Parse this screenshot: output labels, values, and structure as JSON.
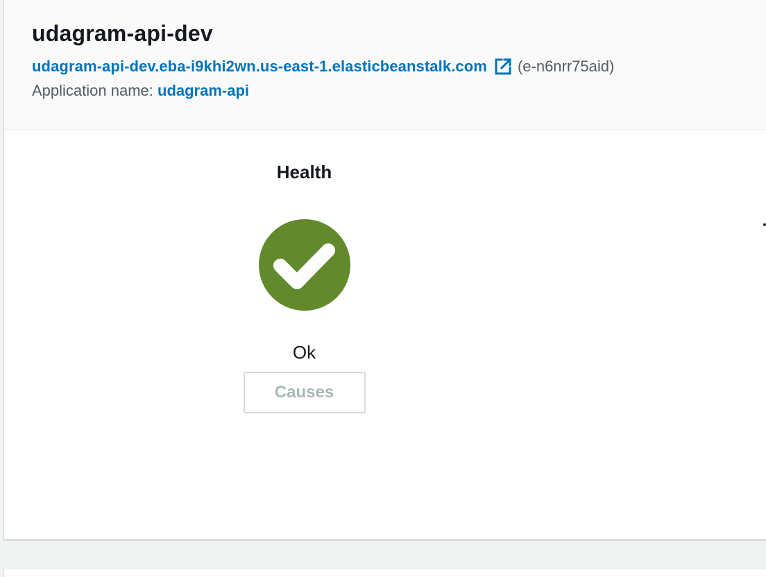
{
  "environment": {
    "name": "udagram-api-dev",
    "url": "udagram-api-dev.eba-i9khi2wn.us-east-1.elasticbeanstalk.com",
    "id": "(e-n6nrr75aid)",
    "application_label": "Application name: ",
    "application_name": "udagram-api",
    "external_link_icon": "external-link-icon"
  },
  "health": {
    "heading": "Health",
    "status": "Ok",
    "status_icon": "check-circle-icon",
    "status_color": "#62892c",
    "causes_button_label": "Causes",
    "causes_enabled": false
  },
  "colors": {
    "link": "#0073bb",
    "text": "#16191f",
    "secondary_text": "#545b64",
    "disabled_text": "#aab7b8",
    "page_background": "#f2f3f3",
    "header_background": "#fafafa"
  }
}
